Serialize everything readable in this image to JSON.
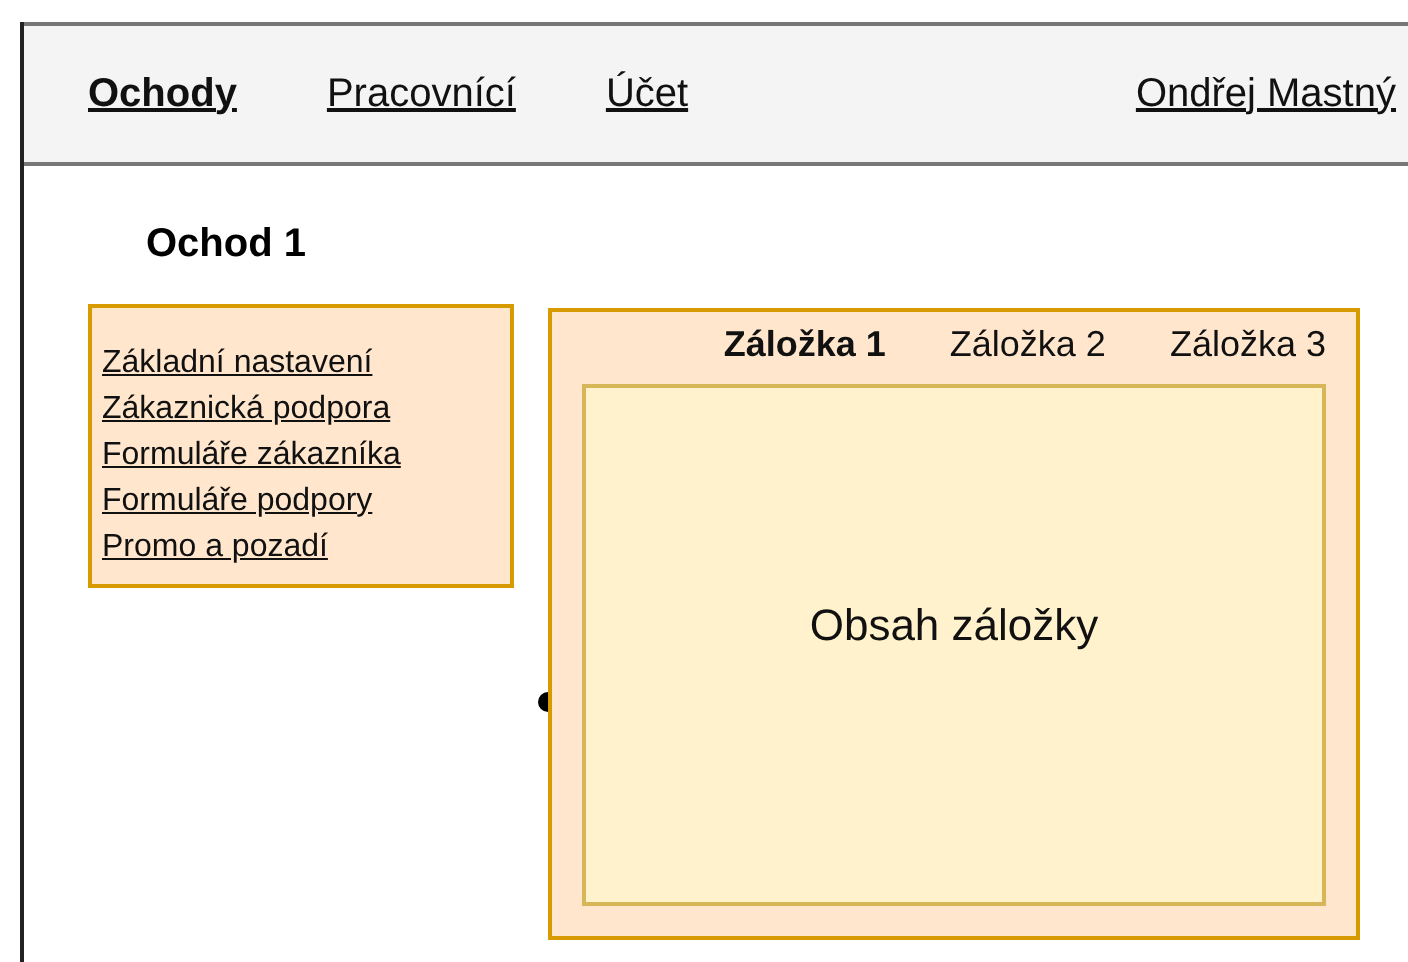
{
  "nav": [
    {
      "label": "Ochody",
      "selected": true
    },
    {
      "label": "Pracovnící",
      "selected": false
    },
    {
      "label": "Účet",
      "selected": false
    }
  ],
  "user_link": "Ondřej Mastný",
  "page_title": "Ochod 1",
  "menu": [
    "Základní nastavení",
    "Zákaznická podpora",
    "Formuláře zákazníka",
    "Formuláře podpory",
    "Promo a pozadí"
  ],
  "tabs": [
    {
      "label": "Záložka 1",
      "selected": true
    },
    {
      "label": "Záložka 2",
      "selected": false
    },
    {
      "label": "Záložka 3",
      "selected": false
    }
  ],
  "tab_content": "Obsah záložky"
}
